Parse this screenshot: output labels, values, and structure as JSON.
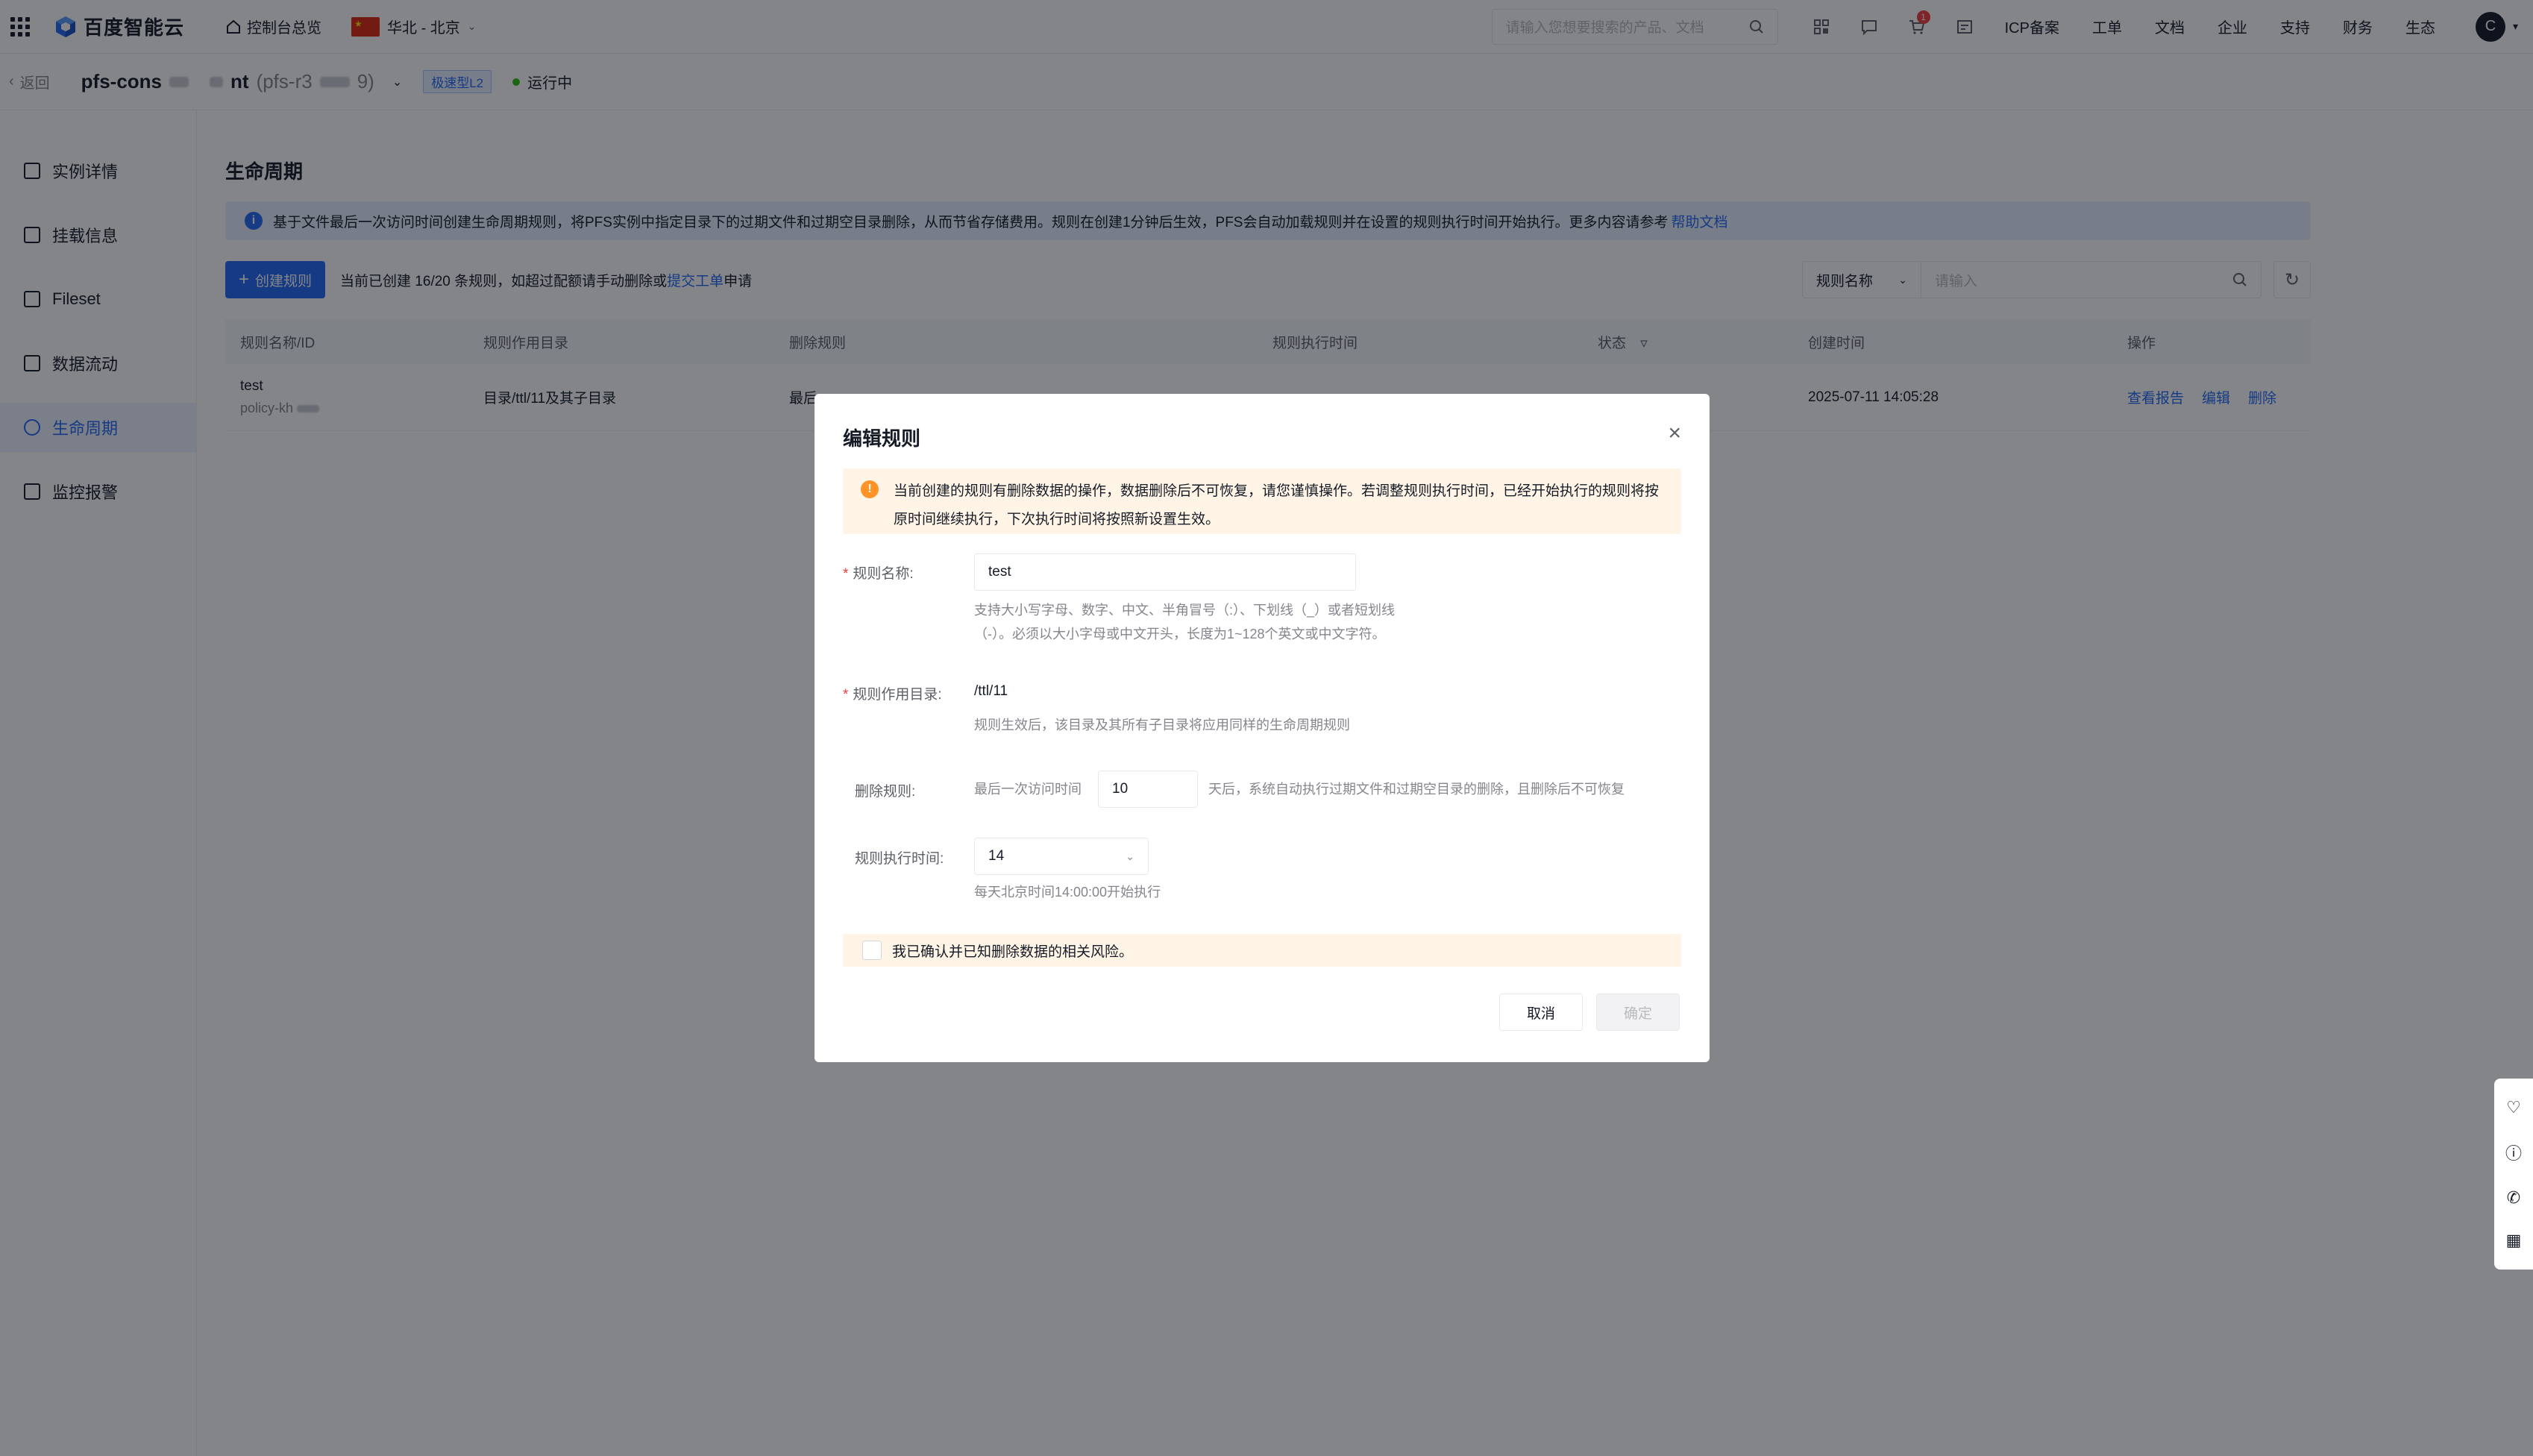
{
  "topbar": {
    "logo_text": "百度智能云",
    "home_label": "控制台总览",
    "region_label": "华北 - 北京",
    "search_placeholder": "请输入您想要搜索的产品、文档",
    "cart_badge": "1",
    "menu": [
      "ICP备案",
      "工单",
      "文档",
      "企业",
      "支持",
      "财务",
      "生态"
    ],
    "avatar_letter": "C"
  },
  "subheader": {
    "back_label": "返回",
    "instance_name_prefix": "pfs-cons",
    "instance_name_mid": "nt",
    "instance_id_prefix": "(pfs-r3",
    "instance_id_suffix": "9)",
    "type_tag": "极速型L2",
    "status": "运行中"
  },
  "sidebar": {
    "items": [
      {
        "label": "实例详情"
      },
      {
        "label": "挂载信息"
      },
      {
        "label": "Fileset"
      },
      {
        "label": "数据流动"
      },
      {
        "label": "生命周期"
      },
      {
        "label": "监控报警"
      }
    ]
  },
  "main": {
    "title": "生命周期",
    "info_text": "基于文件最后一次访问时间创建生命周期规则，将PFS实例中指定目录下的过期文件和过期空目录删除，从而节省存储费用。规则在创建1分钟后生效，PFS会自动加载规则并在设置的规则执行时间开始执行。更多内容请参考",
    "info_link": "帮助文档",
    "create_button": "创建规则",
    "quota_prefix": "当前已创建 16/20 条规则，如超过配额请手动删除或",
    "quota_link": "提交工单",
    "quota_suffix": "申请",
    "filter_select": "规则名称",
    "search_placeholder": "请输入",
    "columns": [
      "规则名称/ID",
      "规则作用目录",
      "删除规则",
      "规则执行时间",
      "状态",
      "创建时间",
      "操作"
    ],
    "rows": [
      {
        "name": "test",
        "id": "policy-kh",
        "dir": "目录/ttl/11及其子目录",
        "rule": "最后",
        "exec_time": "",
        "status": "",
        "created": "2025-07-11 14:05:28",
        "ops": [
          "查看报告",
          "编辑",
          "删除"
        ]
      }
    ]
  },
  "modal": {
    "title": "编辑规则",
    "warning": "当前创建的规则有删除数据的操作，数据删除后不可恢复，请您谨慎操作。若调整规则执行时间，已经开始执行的规则将按原时间继续执行，下次执行时间将按照新设置生效。",
    "name_label": "规则名称:",
    "name_value": "test",
    "name_help_1": "支持大小写字母、数字、中文、半角冒号（:）、下划线（_）或者短划线",
    "name_help_2": "（-）。必须以大小字母或中文开头，长度为1~128个英文或中文字符。",
    "dir_label": "规则作用目录:",
    "dir_value": "/ttl/11",
    "dir_help": "规则生效后，该目录及其所有子目录将应用同样的生命周期规则",
    "delete_label": "删除规则:",
    "delete_prefix": "最后一次访问时间",
    "delete_days": "10",
    "delete_suffix": "天后，系统自动执行过期文件和过期空目录的删除，且删除后不可恢复",
    "exec_label": "规则执行时间:",
    "exec_value": "14",
    "exec_help": "每天北京时间14:00:00开始执行",
    "confirm_text": "我已确认并已知删除数据的相关风险。",
    "cancel": "取消",
    "ok": "确定"
  },
  "colors": {
    "primary": "#2468f2",
    "warning_bg": "#fff4e6",
    "warning_icon": "#ff9326",
    "status_running": "#30bf13"
  }
}
